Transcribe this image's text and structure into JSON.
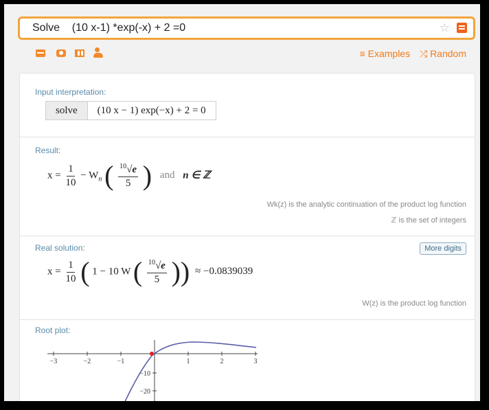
{
  "search": {
    "query": "Solve    (10 x-1) *exp(-x) + 2 =0"
  },
  "toolbar": {
    "examples_label": "≡ Examples",
    "random_label": "⤮ Random"
  },
  "pods": {
    "input": {
      "title": "Input interpretation:",
      "command": "solve",
      "expression": "(10 x − 1) exp(−x) + 2 = 0"
    },
    "result": {
      "title": "Result:",
      "lhs": "x =",
      "frac_num": "1",
      "frac_den": "10",
      "minus_w": "− W",
      "w_sub": "n",
      "root_index": "10",
      "root_radicand": "√e",
      "inner_den": "5",
      "and_text": "and",
      "set_text": "n ∈ ℤ",
      "note1": "Wk(z) is the analytic continuation of the product log function",
      "note2": "ℤ is the set of integers"
    },
    "real": {
      "title": "Real solution:",
      "more_digits": "More digits",
      "lhs": "x =",
      "frac_num": "1",
      "frac_den": "10",
      "inner_text": "1 − 10 W",
      "root_index": "10",
      "root_radicand": "√e",
      "inner_den": "5",
      "approx": "≈ −0.0839039",
      "note": "W(z) is the product log function"
    },
    "plot": {
      "title": "Root plot:",
      "x_ticks": [
        "−3",
        "−2",
        "−1",
        "1",
        "2",
        "3"
      ],
      "y_ticks": [
        "−10",
        "−20"
      ]
    }
  },
  "colors": {
    "accent": "#f07a1a",
    "border": "#f2a43c",
    "pod_title": "#5a8bab",
    "curve": "#5b5ea6",
    "root_point": "#e02020"
  }
}
